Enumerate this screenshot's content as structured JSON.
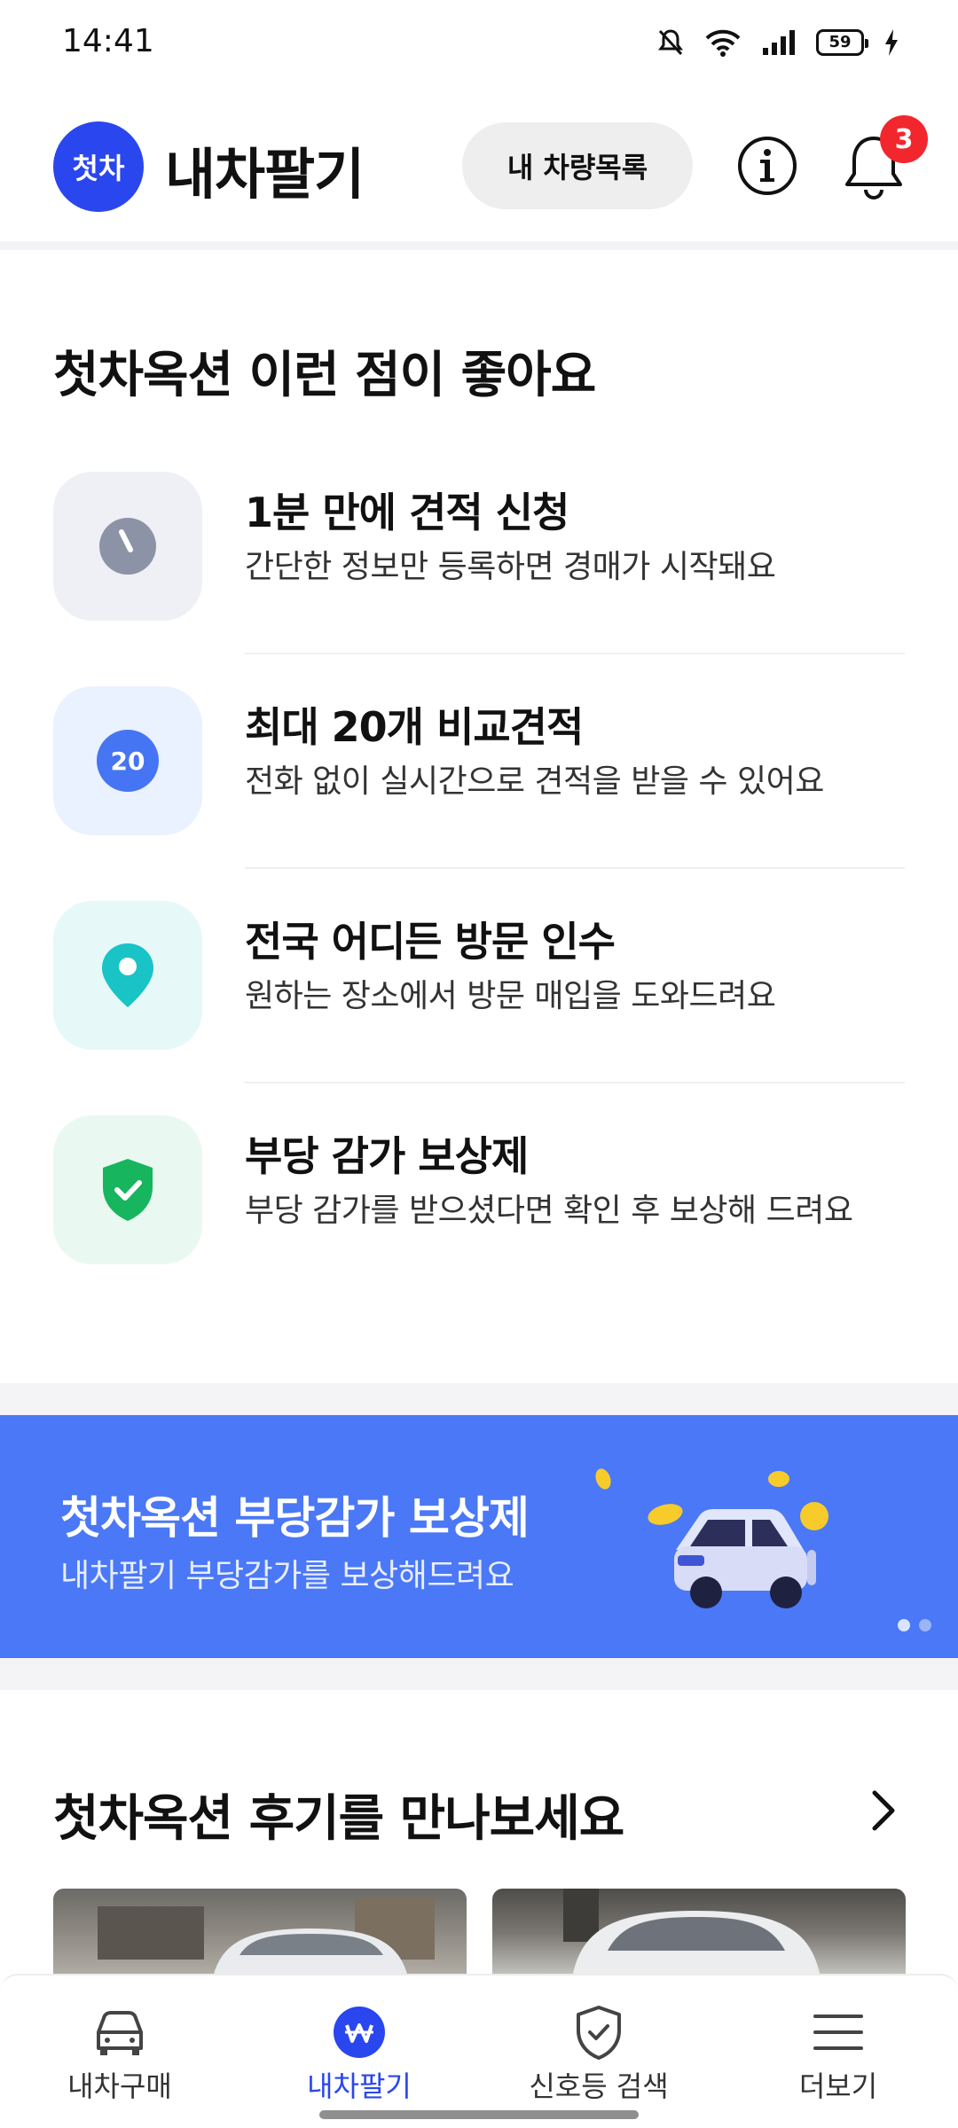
{
  "status_bar": {
    "time": "14:41",
    "battery": "59"
  },
  "header": {
    "logo_text": "첫차",
    "title": "내차팔기",
    "my_cars_button": "내 차량목록",
    "notification_count": "3"
  },
  "benefits": {
    "title": "첫차옥션 이런 점이 좋아요",
    "items": [
      {
        "icon": "clock-icon",
        "title": "1분 만에 견적 신청",
        "desc": "간단한 정보만 등록하면 경매가 시작돼요",
        "icon_bg": "#eef0f5"
      },
      {
        "icon": "twenty-badge-icon",
        "icon_text": "20",
        "title": "최대 20개 비교견적",
        "desc": "전화 없이 실시간으로 견적을 받을 수 있어요",
        "icon_bg": "#eaf1ff"
      },
      {
        "icon": "map-pin-icon",
        "title": "전국 어디든 방문 인수",
        "desc": "원하는 장소에서 방문 매입을 도와드려요",
        "icon_bg": "#e6f8f8"
      },
      {
        "icon": "shield-check-icon",
        "title": "부당 감가 보상제",
        "desc": "부당 감가를 받으셨다면 확인 후 보상해 드려요",
        "icon_bg": "#e9f9f1"
      }
    ]
  },
  "banner": {
    "title": "첫차옥션 부당감가 보상제",
    "subtitle": "내차팔기 부당감가를 보상해드려요",
    "color": "#4a78f6"
  },
  "reviews": {
    "title": "첫차옥션 후기를 만나보세요"
  },
  "bottom_nav": {
    "items": [
      {
        "icon": "car-icon",
        "label": "내차구매"
      },
      {
        "icon": "won-coin-icon",
        "label": "내차팔기",
        "active": true
      },
      {
        "icon": "shield-check-icon",
        "label": "신호등 검색"
      },
      {
        "icon": "menu-icon",
        "label": "더보기"
      }
    ]
  },
  "colors": {
    "accent": "#2a46ee",
    "badge": "#f2272d"
  }
}
